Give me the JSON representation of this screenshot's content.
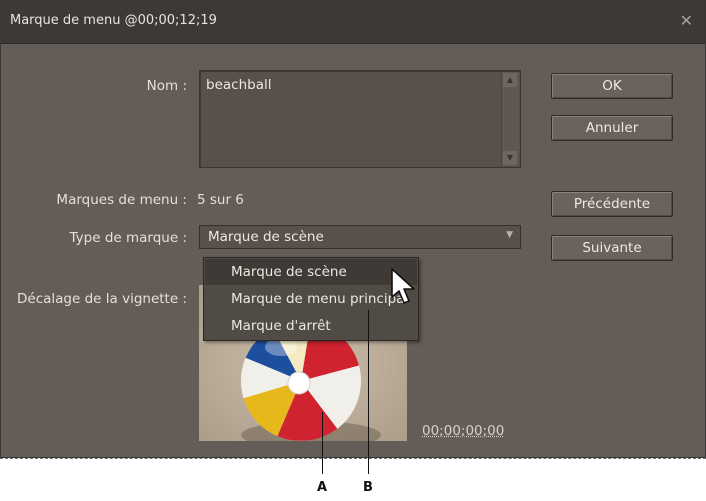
{
  "dialog": {
    "title": "Marque de menu @00;00;12;19",
    "close_icon": "close-icon"
  },
  "form": {
    "name_label": "Nom :",
    "name_value": "beachball",
    "menu_markers_label": "Marques de menu :",
    "menu_markers_value": "5 sur 6",
    "marker_type_label": "Type de marque :",
    "marker_type_value": "Marque de scène",
    "thumbnail_offset_label": "Décalage de la vignette :",
    "thumbnail_timecode": "00;00;00;00"
  },
  "buttons": {
    "ok": "OK",
    "cancel": "Annuler",
    "previous": "Précédente",
    "next": "Suivante"
  },
  "dropdown": {
    "items": [
      "Marque de scène",
      "Marque de menu principal",
      "Marque d'arrêt"
    ],
    "highlighted_index": 0
  },
  "callouts": {
    "a": "A",
    "b": "B"
  },
  "colors": {
    "dialog_bg": "#645d57",
    "titlebar_bg": "#3d3936",
    "menu_highlight": "#3f3a36"
  }
}
